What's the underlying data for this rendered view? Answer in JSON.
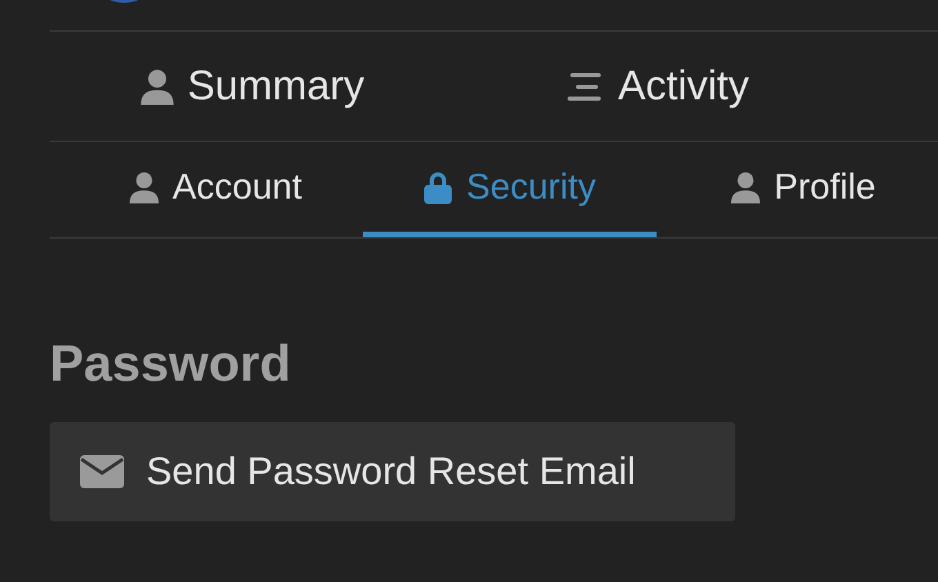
{
  "nav": [
    {
      "label": "Summary",
      "kind": "person"
    },
    {
      "label": "Activity",
      "kind": "list"
    }
  ],
  "tabs": [
    {
      "label": "Account",
      "kind": "person",
      "selected": false
    },
    {
      "label": "Security",
      "kind": "lock",
      "selected": true
    },
    {
      "label": "Profile",
      "kind": "person",
      "selected": false
    }
  ],
  "section": {
    "title": "Password",
    "button": "Send Password Reset Email"
  }
}
